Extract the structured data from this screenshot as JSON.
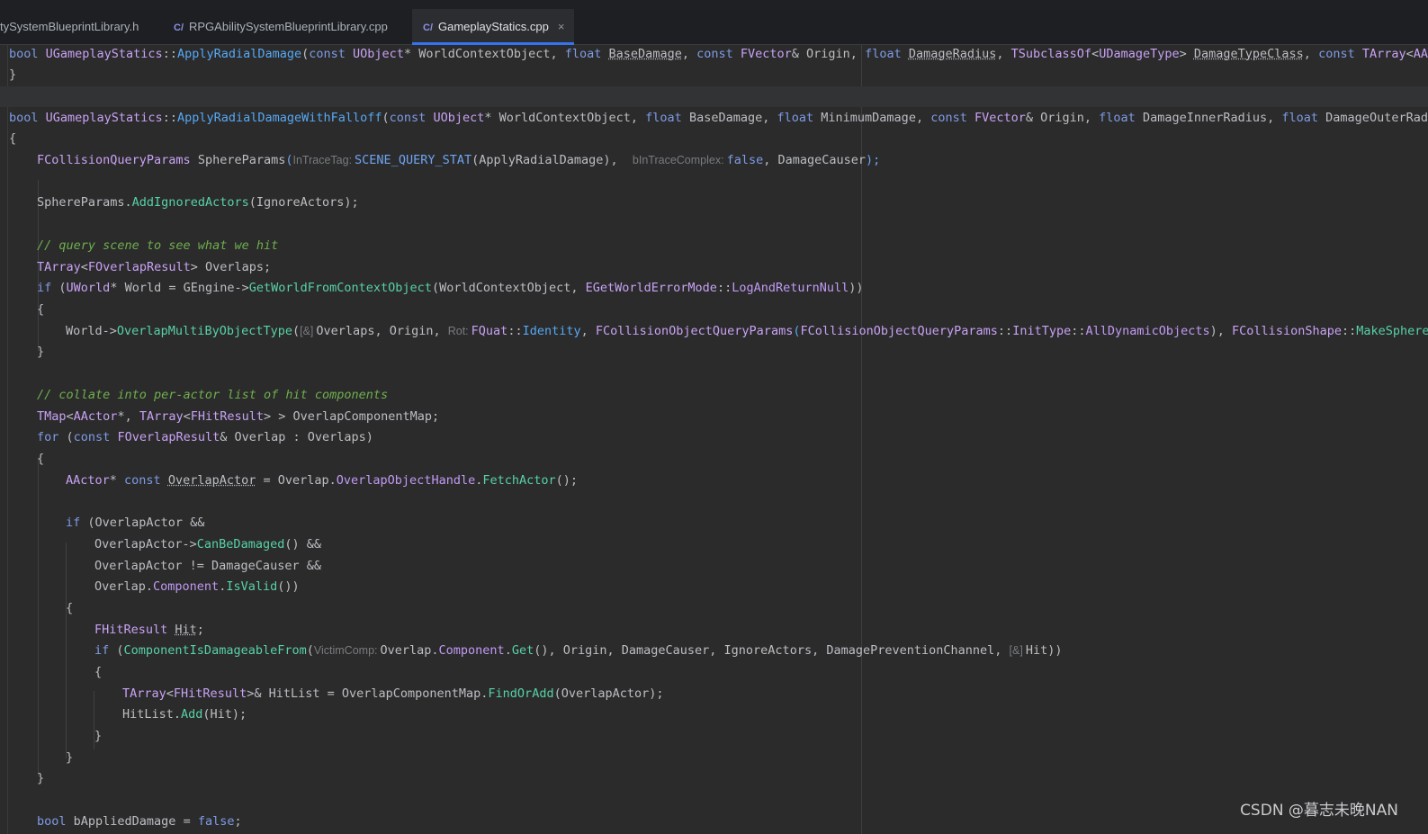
{
  "tabs": [
    {
      "label": "tySystemBlueprintLibrary.h",
      "icon": "",
      "active": false
    },
    {
      "label": "RPGAbilitySystemBlueprintLibrary.cpp",
      "icon": "C/",
      "active": false
    },
    {
      "label": "GameplayStatics.cpp",
      "icon": "C/",
      "active": true,
      "close": "×"
    }
  ],
  "colors": {
    "background": "#2b2b2b",
    "keyword": "#7d9be6",
    "type": "#c8a2f5",
    "function": "#56a8f5",
    "comment": "#6fae4e",
    "accent": "#3574f0"
  },
  "code": {
    "l1": {
      "t1": "bool ",
      "t2": "UGameplayStatics",
      "t3": "::",
      "t4": "ApplyRadialDamage",
      "t5": "(",
      "t6": "const ",
      "t7": "UObject",
      "t8": "* WorldContextObject, ",
      "t9": "float ",
      "t10": "BaseDamage",
      "t11": ", ",
      "t12": "const ",
      "t13": "FVector",
      "t14": "& Origin, ",
      "t15": "float ",
      "t16": "DamageRadius",
      "t17": ", ",
      "t18": "TSubclassOf",
      "t19": "<",
      "t20": "UDamageType",
      "t21": "> ",
      "t22": "DamageTypeClass",
      "t23": ", ",
      "t24": "const ",
      "t25": "TArray",
      "t26": "<",
      "t27": "AActo"
    },
    "l2": {
      "t1": "}"
    },
    "l3": {
      "t1": "bool ",
      "t2": "UGameplayStatics",
      "t3": "::",
      "t4": "ApplyRadialDamageWithFalloff",
      "t5": "(",
      "t6": "const ",
      "t7": "UObject",
      "t8": "* WorldContextObject, ",
      "t9": "float ",
      "t10": "BaseDamage, ",
      "t11": "float ",
      "t12": "MinimumDamage, ",
      "t13": "const ",
      "t14": "FVector",
      "t15": "& Origin, ",
      "t16": "float ",
      "t17": "DamageInnerRadius, ",
      "t18": "float ",
      "t19": "DamageOuterRadius"
    },
    "l4": {
      "t1": "{"
    },
    "l5": {
      "t1": "FCollisionQueryParams ",
      "t2": "SphereParams",
      "t3": "(",
      "t4": "InTraceTag:",
      "t5": "SCENE_QUERY_STAT",
      "t6": "(ApplyRadialDamage),  ",
      "t7": "bInTraceComplex:",
      "t8": "false",
      "t9": ", DamageCauser",
      "t10": ");"
    },
    "l6": {
      "t1": "SphereParams.",
      "t2": "AddIgnoredActors",
      "t3": "(IgnoreActors);"
    },
    "l7": {
      "t1": "// query scene to see what we hit"
    },
    "l8": {
      "t1": "TArray",
      "t2": "<",
      "t3": "FOverlapResult",
      "t4": "> Overlaps;"
    },
    "l9": {
      "t1": "if ",
      "t2": "(",
      "t3": "UWorld",
      "t4": "* World = GEngine->",
      "t5": "GetWorldFromContextObject",
      "t6": "(WorldContextObject, ",
      "t7": "EGetWorldErrorMode",
      "t8": "::",
      "t9": "LogAndReturnNull",
      "t10": "))"
    },
    "l10": {
      "t1": "{"
    },
    "l11": {
      "t1": "World->",
      "t2": "OverlapMultiByObjectType",
      "t3": "(",
      "t4": "[&]",
      "t5": "Overlaps, Origin, ",
      "t6": "Rot:",
      "t7": "FQuat",
      "t8": "::",
      "t9": "Identity",
      "t10": ", ",
      "t11": "FCollisionObjectQueryParams",
      "t12": "(",
      "t13": "FCollisionObjectQueryParams",
      "t14": "::",
      "t15": "InitType",
      "t16": "::",
      "t17": "AllDynamicObjects",
      "t18": "), ",
      "t19": "FCollisionShape",
      "t20": "::",
      "t21": "MakeSphere",
      "t22": "("
    },
    "l12": {
      "t1": "}"
    },
    "l13": {
      "t1": "// collate into per-actor list of hit components"
    },
    "l14": {
      "t1": "TMap",
      "t2": "<",
      "t3": "AActor",
      "t4": "*, ",
      "t5": "TArray",
      "t6": "<",
      "t7": "FHitResult",
      "t8": "> > OverlapComponentMap;"
    },
    "l15": {
      "t1": "for ",
      "t2": "(",
      "t3": "const ",
      "t4": "FOverlapResult",
      "t5": "& Overlap : Overlaps)"
    },
    "l16": {
      "t1": "{"
    },
    "l17": {
      "t1": "AActor",
      "t2": "* ",
      "t3": "const ",
      "t4": "OverlapActor",
      "t5": " = Overlap.",
      "t6": "OverlapObjectHandle",
      "t7": ".",
      "t8": "FetchActor",
      "t9": "();"
    },
    "l18": {
      "t1": "if ",
      "t2": "(OverlapActor &&"
    },
    "l19": {
      "t1": "OverlapActor->",
      "t2": "CanBeDamaged",
      "t3": "() &&"
    },
    "l20": {
      "t1": "OverlapActor != DamageCauser &&"
    },
    "l21": {
      "t1": "Overlap.",
      "t2": "Component",
      "t3": ".",
      "t4": "IsValid",
      "t5": "())"
    },
    "l22": {
      "t1": "{"
    },
    "l23": {
      "t1": "FHitResult ",
      "t2": "Hit",
      "t3": ";"
    },
    "l24": {
      "t1": "if ",
      "t2": "(",
      "t3": "ComponentIsDamageableFrom",
      "t4": "(",
      "t5": "VictimComp:",
      "t6": "Overlap.",
      "t7": "Component",
      "t8": ".",
      "t9": "Get",
      "t10": "(), Origin, DamageCauser, IgnoreActors, DamagePreventionChannel, ",
      "t11": "[&]",
      "t12": "Hit))"
    },
    "l25": {
      "t1": "{"
    },
    "l26": {
      "t1": "TArray",
      "t2": "<",
      "t3": "FHitResult",
      "t4": ">& HitList = OverlapComponentMap.",
      "t5": "FindOrAdd",
      "t6": "(OverlapActor);"
    },
    "l27": {
      "t1": "HitList.",
      "t2": "Add",
      "t3": "(Hit);"
    },
    "l28": {
      "t1": "}"
    },
    "l29": {
      "t1": "}"
    },
    "l30": {
      "t1": "}"
    },
    "l31": {
      "t1": "bool ",
      "t2": "bAppliedDamage",
      "t3": " = ",
      "t4": "false",
      "t5": ";"
    }
  },
  "watermark": "CSDN @暮志未晚NAN"
}
